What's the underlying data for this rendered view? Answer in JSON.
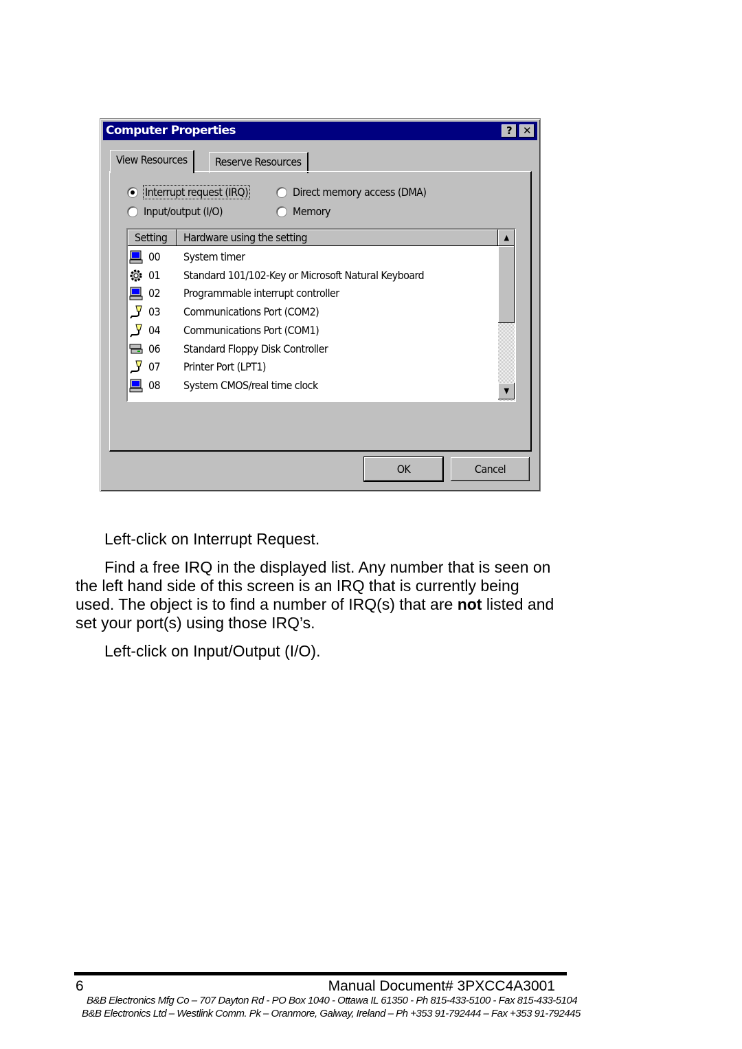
{
  "dialog": {
    "title": "Computer Properties",
    "help_label": "?",
    "close_label": "✕",
    "tabs": [
      "View Resources",
      "Reserve Resources"
    ],
    "radios": [
      {
        "label": "Interrupt request (IRQ)",
        "checked": true
      },
      {
        "label": "Direct memory access (DMA)",
        "checked": false
      },
      {
        "label": "Input/output (I/O)",
        "checked": false
      },
      {
        "label": "Memory",
        "checked": false
      }
    ],
    "columns": [
      "Setting",
      "Hardware using the setting"
    ],
    "rows": [
      {
        "icon": "computer-icon",
        "setting": "00",
        "hardware": "System timer"
      },
      {
        "icon": "keyboard-icon",
        "setting": "01",
        "hardware": "Standard 101/102-Key or Microsoft Natural Keyboard"
      },
      {
        "icon": "computer-icon",
        "setting": "02",
        "hardware": "Programmable interrupt controller"
      },
      {
        "icon": "port-icon",
        "setting": "03",
        "hardware": "Communications Port (COM2)"
      },
      {
        "icon": "port-icon",
        "setting": "04",
        "hardware": "Communications Port (COM1)"
      },
      {
        "icon": "floppy-controller-icon",
        "setting": "06",
        "hardware": "Standard Floppy Disk Controller"
      },
      {
        "icon": "port-icon",
        "setting": "07",
        "hardware": "Printer Port (LPT1)"
      },
      {
        "icon": "computer-icon",
        "setting": "08",
        "hardware": "System CMOS/real time clock"
      }
    ],
    "ok_label": "OK",
    "cancel_label": "Cancel"
  },
  "body": {
    "p1": "Left-click on Interrupt Request.",
    "p2_line1": "Find a free IRQ in the displayed list. Any number that is seen on",
    "p2_line2": "the left hand side of this screen is an IRQ that is currently being",
    "p2_line3a": "used. The object is to find a number of IRQ(s) that are ",
    "p2_bold": "not",
    "p2_line3b": " listed and",
    "p2_line4": "set your port(s) using those IRQ’s.",
    "p3": "Left-click on Input/Output (I/O)."
  },
  "footer": {
    "page_number": "6",
    "doc_number": "Manual Document# 3PXCC4A3001",
    "line1": "B&B Electronics Mfg Co – 707 Dayton Rd - PO Box 1040 - Ottawa IL 61350 - Ph 815-433-5100 - Fax 815-433-5104",
    "line2": "B&B Electronics Ltd – Westlink Comm. Pk – Oranmore, Galway, Ireland – Ph +353 91-792444 – Fax +353 91-792445"
  }
}
